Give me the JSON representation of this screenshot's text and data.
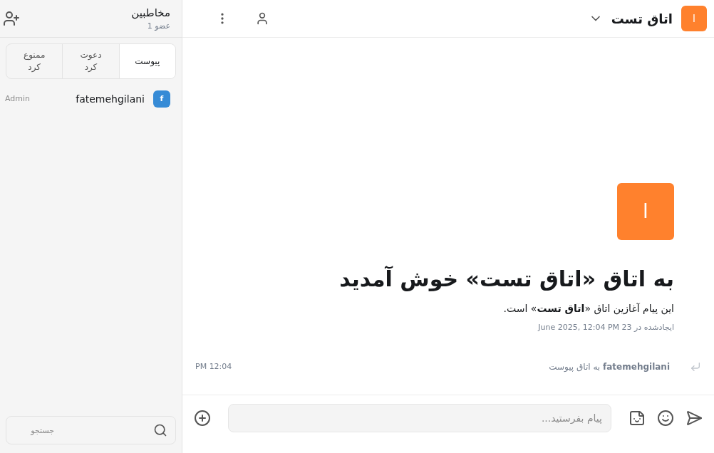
{
  "room": {
    "avatar": "ا",
    "title": "اتاق تست"
  },
  "welcome": {
    "avatar": "ا",
    "heading": "به اتاق «اتاق تست» خوش آمدید",
    "intro": "این پیام آغازین اتاق «**اتاق تست**» است.",
    "created": "ایجادشده در 23 June 2025, 12:04 PM"
  },
  "events": [
    {
      "user": "fatemehgilani",
      "text": "به اتاق پیوست",
      "time": "12:04 PM"
    }
  ],
  "composer": {
    "placeholder": "پیام بفرستید..."
  },
  "sidebar": {
    "title": "مخاطبین",
    "count": "1 عضو",
    "tabs": [
      {
        "label": "پیوست",
        "selected": true
      },
      {
        "label": "دعوت کرد",
        "selected": false
      },
      {
        "label": "ممنوع کرد",
        "selected": false
      }
    ],
    "members": [
      {
        "avatar": "f",
        "name": "fatemehgilani",
        "role": "Admin",
        "color": "#368bd6"
      }
    ],
    "search": {
      "placeholder": "جستجو"
    }
  }
}
